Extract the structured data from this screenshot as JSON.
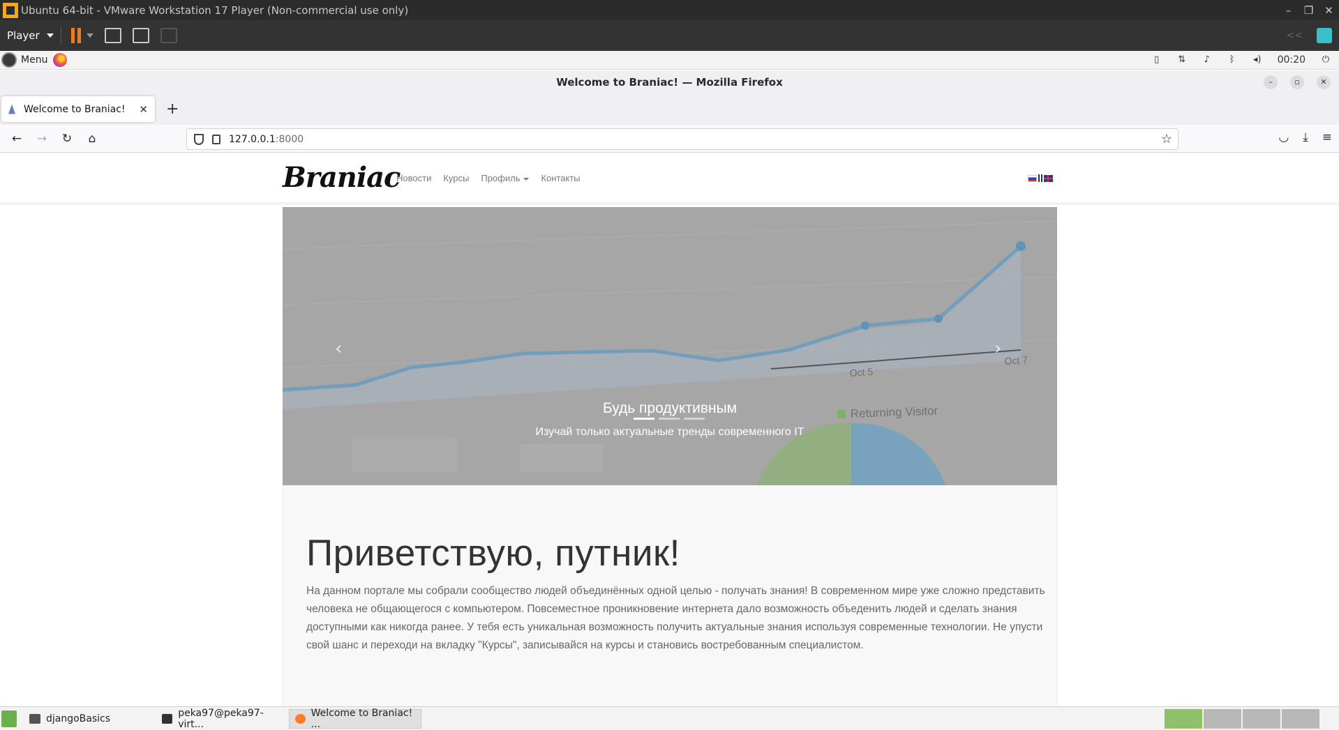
{
  "vmware": {
    "title": "Ubuntu 64-bit - VMware Workstation 17 Player (Non-commercial use only)",
    "player_menu": "Player",
    "win_min": "–",
    "win_max": "❐",
    "win_close": "✕",
    "back_hint": "<<"
  },
  "os_panel": {
    "menu_label": "Menu",
    "clock": "00:20"
  },
  "firefox": {
    "window_title": "Welcome to Braniac! — Mozilla Firefox",
    "tab_title": "Welcome to Braniac!",
    "tab_close": "✕",
    "new_tab": "+",
    "url_host": "127.0.0.1",
    "url_port": ":8000",
    "back": "←",
    "forward": "→",
    "reload": "↻",
    "home": "⌂",
    "star": "☆",
    "pocket": "◡",
    "download": "⤓",
    "menu": "≡"
  },
  "site": {
    "brand": "Braniac",
    "nav": [
      "Новости",
      "Курсы",
      "Профиль",
      "Контакты"
    ],
    "carousel": {
      "title": "Будь продуктивным",
      "subtitle": "Изучай только актуальные тренды современного IT",
      "prev": "‹",
      "next": "›",
      "slides": 3,
      "active_slide": 1,
      "bg_labels": [
        "Oct 5",
        "Oct 7",
        "Returning Visitor"
      ]
    },
    "heading": "Приветствую, путник!",
    "body": "На данном портале мы собрали сообщество людей объединённых одной целью - получать знания! В современном мире уже сложно представить человека не общающегося с компьютером. Повсеместное проникновение интернета дало возможность объеденить людей и сделать знания доступными как никогда ранее. У тебя есть уникальная возможность получить актуальные знания используя современные технологии. Не упусти свой шанс и переходи на вкладку \"Курсы\", записывайся на курсы и становись востребованным специалистом."
  },
  "taskbar": {
    "tasks": [
      "djangoBasics",
      "peka97@peka97-virt...",
      "Welcome to Braniac! ..."
    ]
  },
  "colors": {
    "vm_bar": "#2b2b2b",
    "accent_orange": "#f07b1c",
    "carousel_bg": "#a3a3a3",
    "chart_line": "#5b9ec9"
  }
}
